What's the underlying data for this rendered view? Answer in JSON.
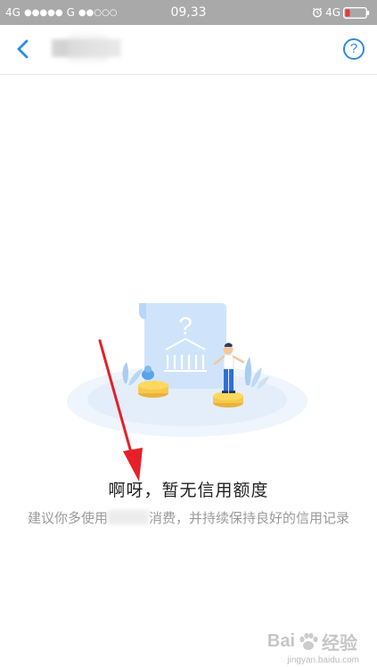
{
  "status_bar": {
    "carrier_left": "4G",
    "signal_dots_1": "●●●●●",
    "carrier_mid": "G",
    "signal_dots_2": "●●○○○",
    "time": "09,33",
    "network_right": "4G",
    "icons": [
      "alarm-icon",
      "battery-icon"
    ]
  },
  "nav": {
    "back_icon": "chevron-left-icon",
    "help_icon": "question-circle-icon",
    "help_label": "?",
    "accent_color": "#2a8ce6"
  },
  "empty_state": {
    "title": "啊呀，暂无信用额度",
    "subtitle_before": "建议你多使用",
    "subtitle_after": "消费，并持续保持良好的信用记录",
    "illustration_icon": "empty-credit-illustration"
  },
  "watermark": {
    "text": "Bai",
    "text_cn": "经验",
    "sub": "jingyan.baidu.com"
  }
}
